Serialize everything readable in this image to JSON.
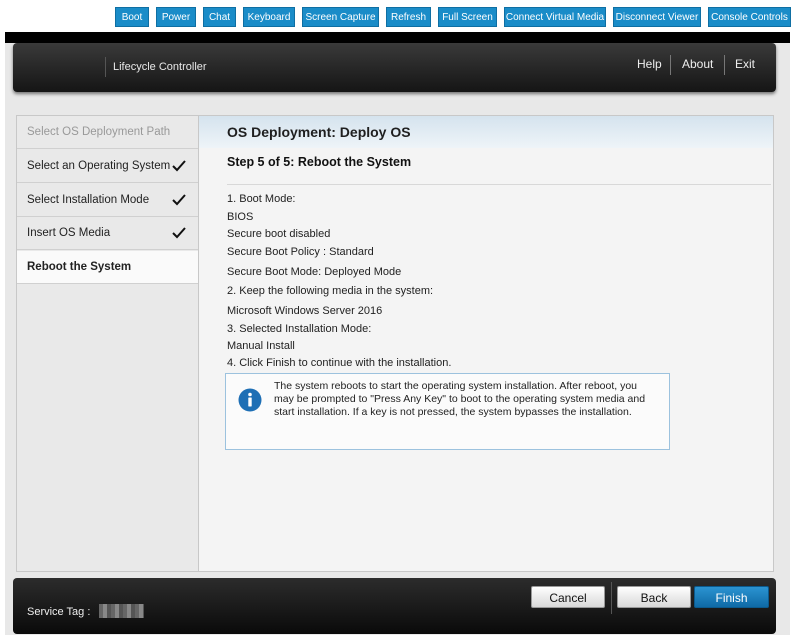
{
  "toolbar": {
    "buttons": [
      "Boot",
      "Power",
      "Chat",
      "Keyboard",
      "Screen Capture",
      "Refresh",
      "Full Screen",
      "Connect Virtual Media",
      "Disconnect Viewer",
      "Console Controls"
    ]
  },
  "header": {
    "title": "Lifecycle Controller",
    "links": [
      "Help",
      "About",
      "Exit"
    ]
  },
  "sidebar": {
    "items": [
      {
        "label": "Select OS Deployment Path",
        "state": "disabled"
      },
      {
        "label": "Select an Operating System",
        "state": "done"
      },
      {
        "label": "Select Installation Mode",
        "state": "done"
      },
      {
        "label": "Insert OS Media",
        "state": "done"
      },
      {
        "label": "Reboot the System",
        "state": "active"
      }
    ]
  },
  "content": {
    "title": "OS Deployment: Deploy OS",
    "step_title": "Step 5 of 5: Reboot the System",
    "lines": [
      "1. Boot Mode:",
      "BIOS",
      "Secure boot disabled",
      "Secure Boot Policy : Standard",
      "Secure Boot Mode: Deployed Mode",
      "2. Keep the following media in the system:",
      "Microsoft Windows Server 2016",
      "3. Selected Installation Mode:",
      "Manual Install",
      "4. Click Finish to continue with the installation."
    ],
    "info": "The system reboots to start the operating system installation. After reboot, you may be prompted to \"Press Any Key\" to boot to the operating system media and start installation. If a key is not pressed, the system bypasses the installation."
  },
  "footer": {
    "service_tag_label": "Service Tag :",
    "cancel": "Cancel",
    "back": "Back",
    "finish": "Finish"
  },
  "colors": {
    "accent": "#1a8cc8",
    "finish_button": "#1a7bbd",
    "info_icon": "#1e6fb5"
  }
}
